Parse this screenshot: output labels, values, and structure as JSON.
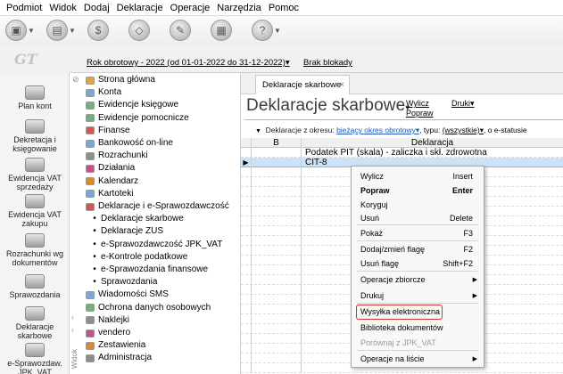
{
  "menubar": [
    "Podmiot",
    "Widok",
    "Dodaj",
    "Deklaracje",
    "Operacje",
    "Narzędzia",
    "Pomoc"
  ],
  "logo": "GT",
  "top": {
    "rok": "Rok obrotowy - 2022  (od 01-01-2022 do 31-12-2022)▾",
    "blokady": "Brak blokady"
  },
  "left_panel": [
    {
      "label": "Plan kont"
    },
    {
      "label": "Dekretacja i\nksięgowanie"
    },
    {
      "label": "Ewidencja VAT\nsprzedaży"
    },
    {
      "label": "Ewidencja VAT\nzakupu"
    },
    {
      "label": "Rozrachunki wg\ndokumentów"
    },
    {
      "label": "Sprawozdania"
    },
    {
      "label": "Deklaracje\nskarbowe"
    },
    {
      "label": "e-Sprawozdaw.\nJPK_VAT"
    }
  ],
  "tree": [
    {
      "label": "Strona główna",
      "kind": "icon"
    },
    {
      "label": "Konta",
      "kind": "icon"
    },
    {
      "label": "Ewidencje księgowe",
      "kind": "icon"
    },
    {
      "label": "Ewidencje pomocnicze",
      "kind": "icon"
    },
    {
      "label": "Finanse",
      "kind": "icon"
    },
    {
      "label": "Bankowość on-line",
      "kind": "icon"
    },
    {
      "label": "Rozrachunki",
      "kind": "icon"
    },
    {
      "label": "Działania",
      "kind": "icon"
    },
    {
      "label": "Kalendarz",
      "kind": "icon"
    },
    {
      "label": "Kartoteki",
      "kind": "icon"
    },
    {
      "label": "Deklaracje i e-Sprawozdawczość",
      "kind": "icon"
    },
    {
      "label": "Deklaracje skarbowe",
      "kind": "bullet"
    },
    {
      "label": "Deklaracje ZUS",
      "kind": "bullet"
    },
    {
      "label": "e-Sprawozdawczość JPK_VAT",
      "kind": "bullet"
    },
    {
      "label": "e-Kontrole podatkowe",
      "kind": "bullet"
    },
    {
      "label": "e-Sprawozdania finansowe",
      "kind": "bullet"
    },
    {
      "label": "Sprawozdania",
      "kind": "bullet"
    },
    {
      "label": "Wiadomości SMS",
      "kind": "icon"
    },
    {
      "label": "Ochrona danych osobowych",
      "kind": "icon"
    },
    {
      "label": "Naklejki",
      "kind": "icon"
    },
    {
      "label": "vendero",
      "kind": "icon"
    },
    {
      "label": "Zestawienia",
      "kind": "icon"
    },
    {
      "label": "Administracja",
      "kind": "icon"
    }
  ],
  "tree_scroll_label": "Widok",
  "tab": {
    "label": "Deklaracje skarbowe",
    "close": "×"
  },
  "page": {
    "title": "Deklaracje skarbowe",
    "wylicz": "Wylicz",
    "popraw": "Popraw",
    "druki": "Druki▾"
  },
  "filter": {
    "label": "Deklaracje z okresu:",
    "period": "bieżący okres obrotowy▾",
    "type_label": ", typu:",
    "type": "(wszystkie)▾",
    "rest": ", o e-statusie"
  },
  "grid": {
    "headers": {
      "b": "B",
      "d": "Deklaracja"
    },
    "rows": [
      {
        "b": "",
        "d": "Podatek PIT (skala) - zaliczka i skł. zdrowotna",
        "selected": false
      },
      {
        "b": "",
        "d": "CIT-8",
        "selected": true
      }
    ]
  },
  "context_menu": [
    {
      "label": "Wylicz",
      "shortcut": "Insert"
    },
    {
      "label": "Popraw",
      "shortcut": "Enter",
      "bold": true
    },
    {
      "label": "Koryguj",
      "shortcut": ""
    },
    {
      "label": "Usuń",
      "shortcut": "Delete"
    },
    {
      "label": "Pokaż",
      "shortcut": "F3"
    },
    {
      "label": "Dodaj/zmień flagę",
      "shortcut": "F2"
    },
    {
      "label": "Usuń flagę",
      "shortcut": "Shift+F2"
    },
    {
      "label": "Operacje zbiorcze",
      "shortcut": "",
      "submenu": true
    },
    {
      "label": "Drukuj",
      "shortcut": "",
      "submenu": true
    },
    {
      "label": "Wysyłka elektroniczna",
      "shortcut": "",
      "highlighted": true
    },
    {
      "label": "Biblioteka dokumentów",
      "shortcut": ""
    },
    {
      "label": "Porównaj z JPK_VAT",
      "shortcut": "",
      "disabled": true
    },
    {
      "label": "Operacje na liście",
      "shortcut": "",
      "submenu": true
    }
  ],
  "colors": {
    "highlight_box": "#d9302a",
    "selected_row": "#cce2f7",
    "link": "#1c5ab5"
  }
}
